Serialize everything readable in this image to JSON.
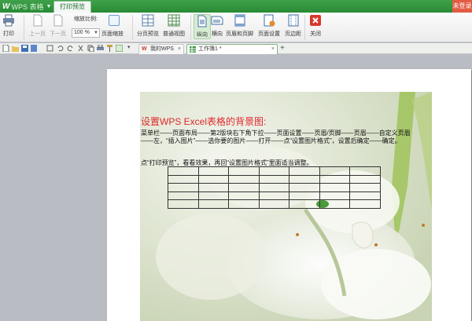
{
  "titlebar": {
    "app_name": "WPS 表格",
    "app_dropdown": "▼",
    "active_tab": "打印预览",
    "login": "未登录"
  },
  "ribbon": {
    "print": "打印",
    "prev_page": "上一页",
    "next_page": "下一页",
    "zoom_label": "缩放比例:",
    "zoom_value": "100 %",
    "page_zoom": "页面缩放",
    "page_break_preview": "分页预览",
    "normal_view": "普通视图",
    "portrait": "纵向",
    "landscape": "横向",
    "header_footer": "页眉和页脚",
    "page_setup": "页面设置",
    "margins": "页边距",
    "close": "关闭"
  },
  "tabs": [
    {
      "label": "我的WPS"
    },
    {
      "label": "工作簿1 *"
    }
  ],
  "tab_close": "×",
  "new_tab": "+",
  "sheet": {
    "title": "设置WPS Excel表格的背景图:",
    "body": "菜单栏——页面布局——第2版块右下角下拉——页面设置——页眉/页脚——页眉——自定义页眉——左，“插入图片”——选你要的图片——打开——点“设置图片格式”，设置后确定——确定。",
    "body2": "点“打印预览”，看看效果，再回“设置图片格式”里面适当调整。",
    "table_rows": 5,
    "table_cols": 7
  },
  "colors": {
    "titlebar": "#2e8f39",
    "accent": "#e0262a",
    "login_bg": "#e25b43"
  }
}
